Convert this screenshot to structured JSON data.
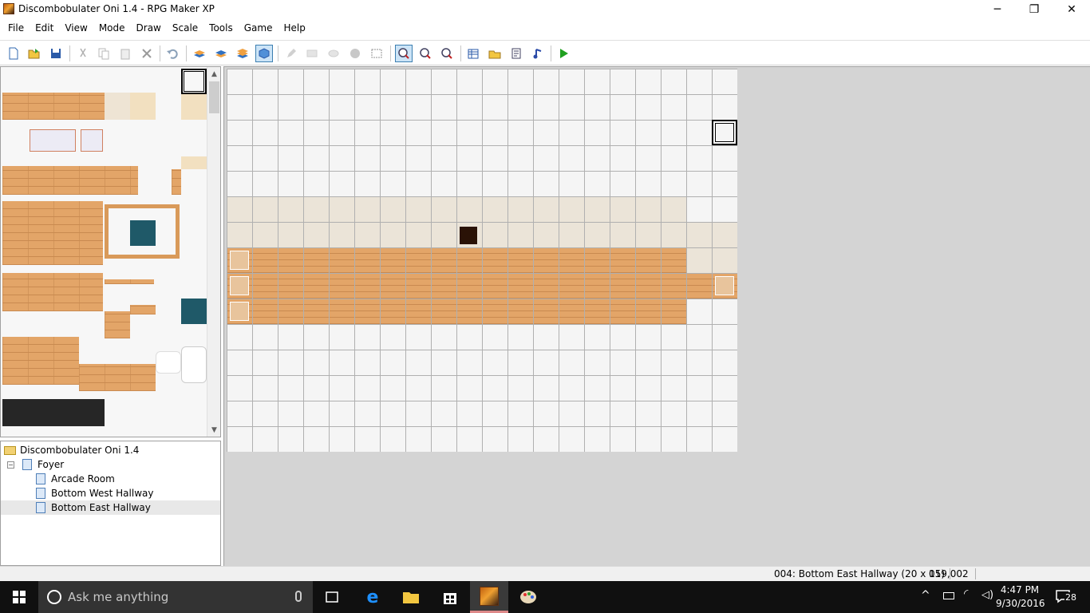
{
  "window": {
    "title": "Discombobulater Oni 1.4 - RPG Maker XP",
    "minimize": "─",
    "maximize": "❐",
    "close": "✕"
  },
  "menu": [
    "File",
    "Edit",
    "View",
    "Mode",
    "Draw",
    "Scale",
    "Tools",
    "Game",
    "Help"
  ],
  "toolbar": {
    "icons": [
      "new-project-icon",
      "open-project-icon",
      "save-icon",
      "cut-icon",
      "copy-icon",
      "paste-icon",
      "delete-icon",
      "undo-icon",
      "layer-1-icon",
      "layer-2-icon",
      "layer-3-icon",
      "events-layer-icon",
      "pencil-icon",
      "rectangle-icon",
      "ellipse-icon",
      "flood-fill-icon",
      "select-icon",
      "zoom-1-1-icon",
      "zoom-1-2-icon",
      "zoom-1-4-icon",
      "database-icon",
      "materialbase-icon",
      "script-editor-icon",
      "sound-test-icon",
      "playtest-icon"
    ],
    "active": [
      "events-layer-icon",
      "zoom-1-1-icon"
    ]
  },
  "tree": {
    "root": "Discombobulater Oni 1.4",
    "items": [
      {
        "label": "Foyer",
        "level": 1,
        "expander": "−"
      },
      {
        "label": "Arcade Room",
        "level": 2
      },
      {
        "label": "Bottom West Hallway",
        "level": 2
      },
      {
        "label": "Bottom East Hallway",
        "level": 2,
        "selected": true
      }
    ]
  },
  "map": {
    "width": 20,
    "height": 15,
    "cursor": "019,002"
  },
  "status": {
    "map_info": "004: Bottom East Hallway (20 x 15)",
    "coords": "019,002"
  },
  "taskbar": {
    "search_placeholder": "Ask me anything",
    "apps": [
      "task-view-icon",
      "edge-icon",
      "file-explorer-icon",
      "store-icon",
      "rpg-maker-icon",
      "paint-icon"
    ],
    "time": "4:47 PM",
    "date": "9/30/2016",
    "notifications": "28"
  },
  "colors": {
    "wood": "#e3a568",
    "cream": "#ebe4d8",
    "map_bg": "#d4d4d4",
    "teal": "#1f5968",
    "dark": "#2a1206"
  }
}
